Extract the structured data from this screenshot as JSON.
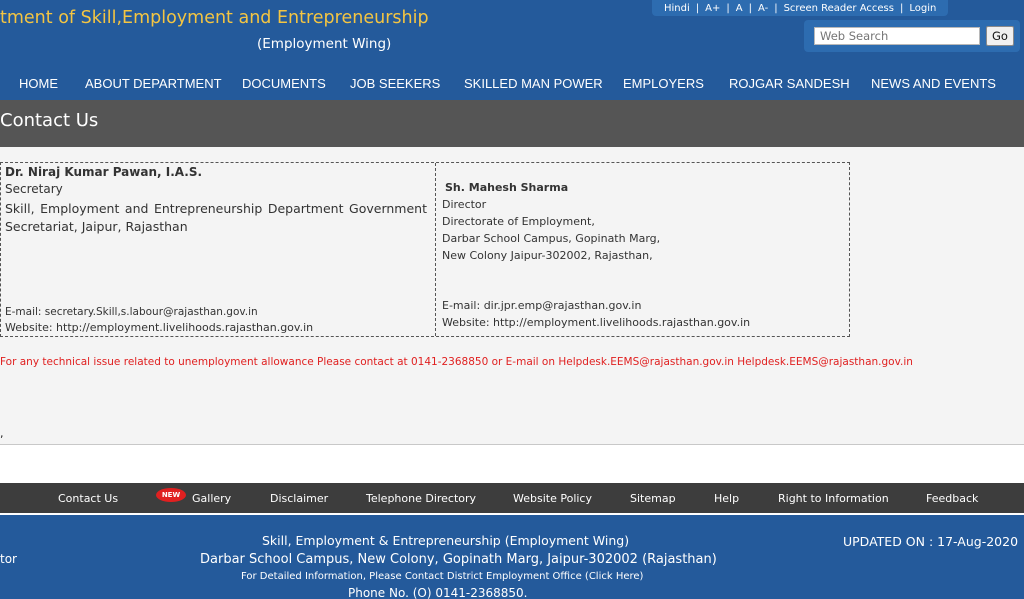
{
  "header": {
    "title": "tment of Skill,Employment and Entrepreneurship",
    "subtitle": "(Employment Wing)",
    "top_links": [
      "Hindi",
      "A+",
      "A",
      "A-",
      "Screen Reader Access",
      "Login"
    ],
    "search": {
      "placeholder": "Web Search",
      "button": "Go"
    }
  },
  "nav": {
    "items": [
      "HOME",
      "ABOUT DEPARTMENT",
      "DOCUMENTS",
      "JOB SEEKERS",
      "SKILLED MAN POWER",
      "EMPLOYERS",
      "ROJGAR SANDESH",
      "NEWS AND EVENTS"
    ]
  },
  "page": {
    "title": "Contact Us"
  },
  "contacts": [
    {
      "name": "Dr. Niraj Kumar Pawan, I.A.S.",
      "designation": "Secretary",
      "address": "Skill, Employment and Entrepreneurship Department Government Secretariat, Jaipur, Rajasthan",
      "email": "E-mail: secretary.Skill,s.labour@rajasthan.gov.in",
      "website": "Website: http://employment.livelihoods.rajasthan.gov.in"
    },
    {
      "name": "Sh. Mahesh Sharma",
      "designation": "Director",
      "address_lines": [
        "Directorate of Employment,",
        "Darbar School Campus, Gopinath Marg,",
        "New Colony Jaipur-302002, Rajasthan,"
      ],
      "email": "E-mail: dir.jpr.emp@rajasthan.gov.in",
      "website": "Website: http://employment.livelihoods.rajasthan.gov.in"
    }
  ],
  "helpdesk_text": "For any technical issue related to unemployment allowance Please contact at   0141-2368850 or E-mail on Helpdesk.EEMS@rajasthan.gov.in Helpdesk.EEMS@rajasthan.gov.in",
  "stray_mark": ",",
  "footer": {
    "links": [
      "Contact Us",
      "Gallery",
      "Disclaimer",
      "Telephone Directory",
      "Website Policy",
      "Sitemap",
      "Help",
      "Right to Information",
      "Feedback"
    ],
    "new_badge": "NEW",
    "info_line1": "Skill, Employment & Entrepreneurship (Employment Wing)",
    "info_line2": "Darbar School Campus, New Colony, Gopinath Marg, Jaipur-302002 (Rajasthan)",
    "info_line3": "For Detailed Information, Please Contact District Employment Office (Click Here)",
    "info_line4": "Phone No. (O) 0141-2368850.",
    "left_fragment": "tor",
    "updated": "UPDATED ON : 17-Aug-2020"
  },
  "colors": {
    "header_blue": "#245a9b",
    "title_gold": "#f4c542",
    "title_band": "#555555",
    "helpdesk_red": "#e02020",
    "footer_dark": "#3d3d3d"
  }
}
